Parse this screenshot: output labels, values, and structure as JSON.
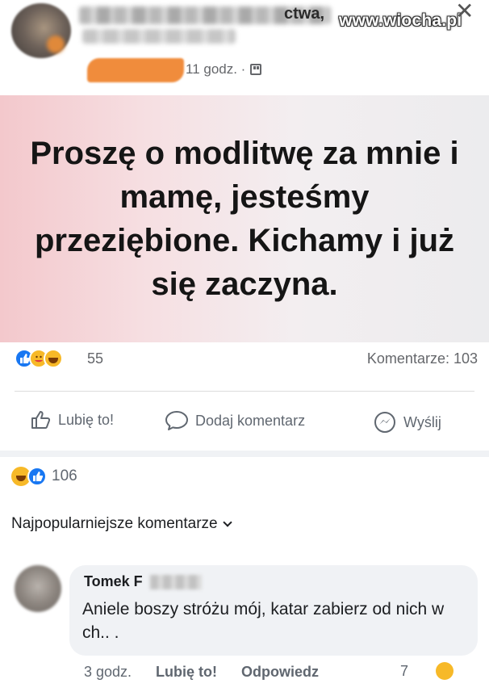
{
  "header": {
    "name_tail": "ctwa,",
    "time": "11 godz. ·",
    "watermark": "www.wiocha.pl",
    "close_glyph": "✕",
    "privacy_icon": "friends-icon"
  },
  "post": {
    "text": "Proszę o modlitwę za mnie i mamę, jesteśmy przeziębione. Kichamy i już się zaczyna.",
    "background_colors": [
      "#f3c8cc",
      "#ececee"
    ]
  },
  "reactions": {
    "icons": [
      "like-icon",
      "care-icon",
      "haha-icon"
    ],
    "count": "55",
    "comments_label": "Komentarze: 103"
  },
  "actions": {
    "like_label": "Lubię to!",
    "comment_label": "Dodaj komentarz",
    "share_label": "Wyślij"
  },
  "comments_section": {
    "reaction_icons": [
      "haha-icon",
      "like-icon"
    ],
    "reaction_count": "106",
    "sort_label": "Najpopularniejsze komentarze"
  },
  "comment": {
    "author": "Tomek F",
    "text": "Aniele boszy stróżu mój, katar zabierz od nich w ch.. .",
    "time": "3 godz.",
    "like_label": "Lubię to!",
    "reply_label": "Odpowiedz",
    "reaction_count": "7"
  },
  "colors": {
    "like_blue": "#1877f2",
    "emoji_yellow": "#f7b928",
    "meta_gray": "#65676b",
    "bubble_bg": "#f0f2f5"
  }
}
